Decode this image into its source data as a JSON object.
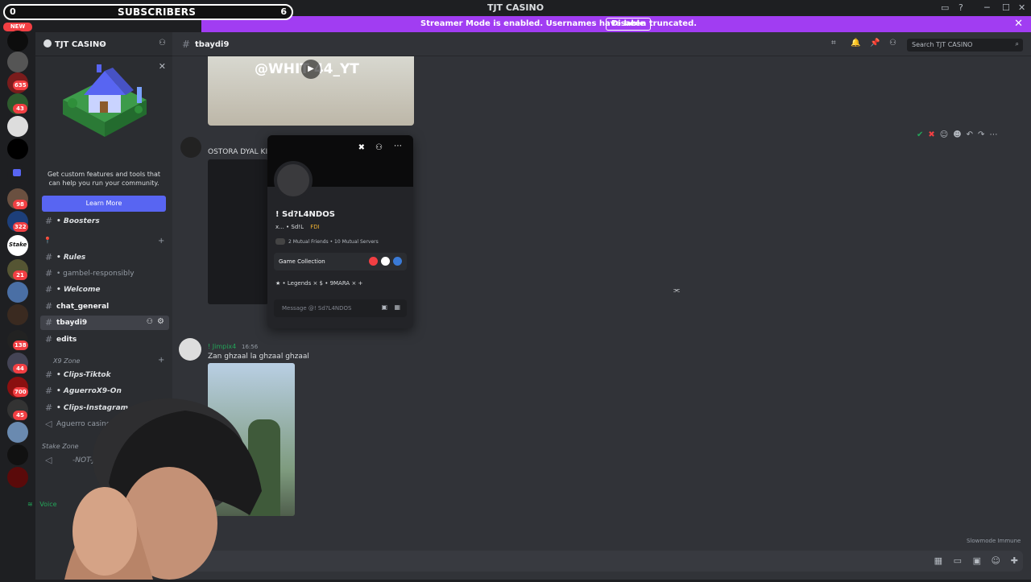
{
  "window": {
    "title": "TJT CASINO"
  },
  "overlay": {
    "subscribers_label": "SUBSCRIBERS",
    "sub_left": "0",
    "sub_right": "6",
    "new_badge": "NEW"
  },
  "banner": {
    "message": "Streamer Mode is enabled. Usernames have been truncated.",
    "button": "Disable"
  },
  "rail_badges": [
    "635",
    "43",
    "98",
    "322",
    "21",
    "138",
    "44",
    "700",
    "45"
  ],
  "server": {
    "name": "TJT CASINO",
    "promo_text": "Get custom features and tools that can help you run your community.",
    "promo_button": "Learn More"
  },
  "channels": [
    {
      "label": "• Boosters",
      "style": "italic"
    },
    {
      "label": "• Rules",
      "style": "italic"
    },
    {
      "label": "• gambel-responsibly",
      "style": "normal"
    },
    {
      "label": "• Welcome",
      "style": "italic"
    },
    {
      "label": "chat_general",
      "style": "bold"
    },
    {
      "label": "tbaydi9",
      "style": "active"
    },
    {
      "label": "edits",
      "style": "bold"
    },
    {
      "label": "• Clips-Tiktok",
      "style": "italic"
    },
    {
      "label": "• AguerroX9-On",
      "style": "italic"
    },
    {
      "label": "• Clips-Instagram",
      "style": "italic"
    },
    {
      "label": "Aguerro casino 1",
      "style": "normal"
    },
    {
      "label": "-NOT-JOIN",
      "style": "italic"
    }
  ],
  "categories": {
    "x9_zone": "X9 Zone",
    "stake_zone": "Stake Zone"
  },
  "voice": {
    "connected": "Voice"
  },
  "chat": {
    "channel": "tbaydi9",
    "search_placeholder": "Search TJT CASINO",
    "video_overlay": "@WHIT  44_YT",
    "msg1_text": "OSTORA DYAL KIC",
    "msg2_author": "! Jimpix4",
    "msg2_time": "16:56",
    "msg2_text": "Zan ghzaal la ghzaal ghzaal",
    "slowmode": "Slowmode Immune"
  },
  "popout": {
    "name": "! Sd?L4NDOS",
    "tag": "x... • Sd!L",
    "tag_badge": "FDI",
    "mutual": "2 Mutual Friends • 10 Mutual Servers",
    "game_collection": "Game Collection",
    "roles": "★ • Legends ×   $ • 9MARA ×   +",
    "message_placeholder": "Message @! Sd?L4NDOS"
  },
  "colors": {
    "accent": "#5865f2",
    "streamer_banner": "#a13df2",
    "badge": "#f23f43"
  }
}
